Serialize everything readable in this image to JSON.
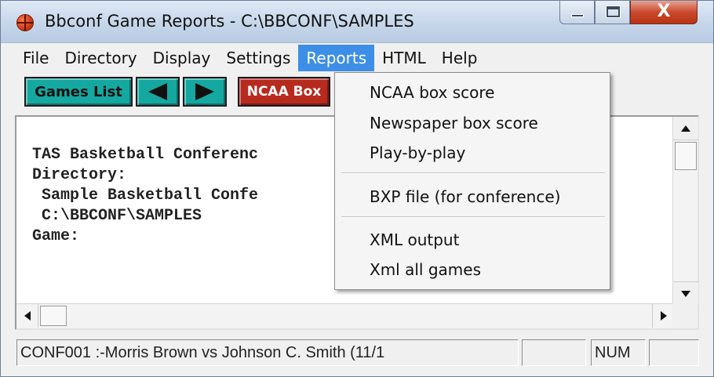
{
  "window": {
    "title": "Bbconf Game Reports - C:\\BBCONF\\SAMPLES",
    "close_glyph": "X"
  },
  "menubar": {
    "items": [
      "File",
      "Directory",
      "Display",
      "Settings",
      "Reports",
      "HTML",
      "Help"
    ],
    "active": "Reports"
  },
  "toolbar": {
    "games_list_label": "Games List",
    "ncaa_box_label": "NCAA Box"
  },
  "reports_menu": {
    "items": [
      "NCAA box score",
      "Newspaper box score",
      "Play-by-play",
      "BXP file (for conference)",
      "XML output",
      "Xml all games"
    ]
  },
  "document": {
    "lines": [
      "TAS Basketball Conferenc",
      "",
      "Directory:",
      " Sample Basketball Confe",
      " C:\\BBCONF\\SAMPLES",
      "",
      "Game:"
    ]
  },
  "statusbar": {
    "main": "CONF001 :-Morris Brown vs Johnson C. Smith (11/1 ",
    "blank1": "",
    "num": "NUM",
    "blank2": ""
  },
  "colors": {
    "menu_highlight": "#3d8ee6",
    "toolbar_teal": "#14a8a0",
    "toolbar_red": "#b72a1e",
    "close_button_red": "#c9492c"
  }
}
